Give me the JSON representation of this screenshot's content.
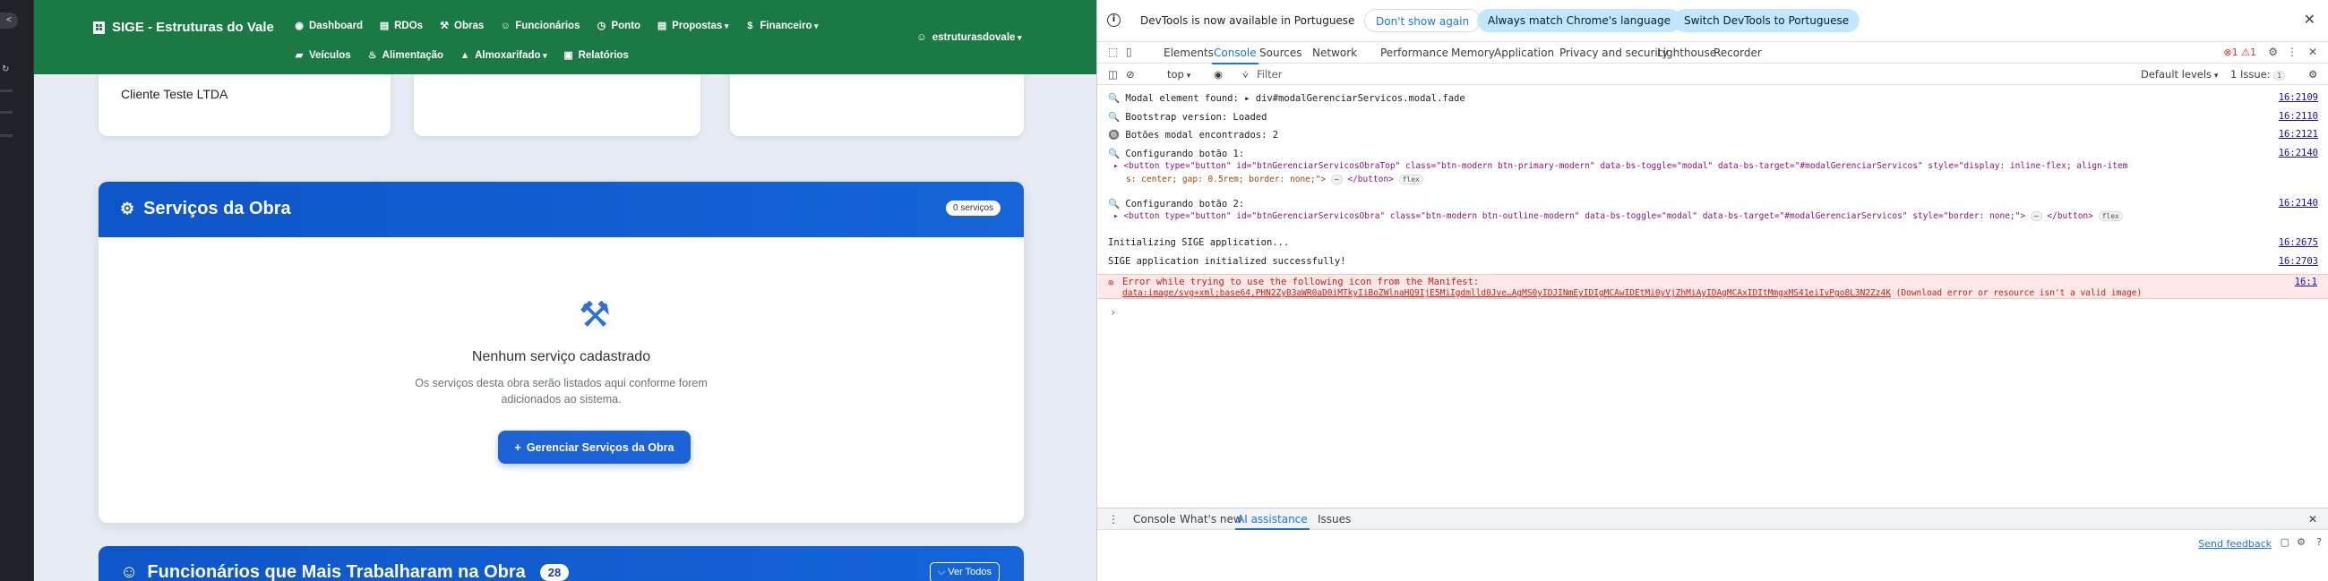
{
  "app": {
    "brand": "SIGE - Estruturas do Vale",
    "nav_row1": [
      {
        "label": "Dashboard",
        "icon": "dashboard-icon",
        "glyph": "◉",
        "caret": false
      },
      {
        "label": "RDOs",
        "icon": "file-icon",
        "glyph": "▤",
        "caret": false
      },
      {
        "label": "Obras",
        "icon": "hammer-icon",
        "glyph": "⚒",
        "caret": false
      },
      {
        "label": "Funcionários",
        "icon": "users-icon",
        "glyph": "☺",
        "caret": false
      },
      {
        "label": "Ponto",
        "icon": "clock-icon",
        "glyph": "◷",
        "caret": false
      },
      {
        "label": "Propostas",
        "icon": "document-icon",
        "glyph": "▤",
        "caret": true
      },
      {
        "label": "Financeiro",
        "icon": "dollar-icon",
        "glyph": "$",
        "caret": true
      }
    ],
    "nav_row2": [
      {
        "label": "Veículos",
        "icon": "car-icon",
        "glyph": "▰",
        "caret": false
      },
      {
        "label": "Alimentação",
        "icon": "utensils-icon",
        "glyph": "♨",
        "caret": false
      },
      {
        "label": "Almoxarifado",
        "icon": "warehouse-icon",
        "glyph": "▲",
        "caret": true
      },
      {
        "label": "Relatórios",
        "icon": "report-icon",
        "glyph": "▣",
        "caret": false
      }
    ],
    "user": "estruturasdovale",
    "client_text": "Cliente Teste LTDA",
    "services": {
      "title": "Serviços da Obra",
      "badge": "0 serviços",
      "empty_title": "Nenhum serviço cadastrado",
      "empty_desc": "Os serviços desta obra serão listados aqui conforme forem adicionados ao sistema.",
      "button": "Gerenciar Serviços da Obra"
    },
    "workers": {
      "title": "Funcionários que Mais Trabalharam na Obra",
      "count": "28",
      "button": "Ver Todos"
    }
  },
  "devtools": {
    "infobar": {
      "message": "DevTools is now available in Portuguese",
      "btn_dont_show": "Don't show again",
      "btn_match": "Always match Chrome's language",
      "btn_switch": "Switch DevTools to Portuguese"
    },
    "tabs": [
      "Elements",
      "Console",
      "Sources",
      "Network",
      "Performance",
      "Memory",
      "Application",
      "Privacy and security",
      "Lighthouse",
      "Recorder"
    ],
    "active_tab": "Console",
    "error_count": "1",
    "warning_count": "1",
    "filter": {
      "context": "top",
      "placeholder": "Filter",
      "levels": "Default levels",
      "issues": "1 Issue:",
      "issues_count": "1"
    },
    "console_lines": [
      {
        "text": "🔍 Modal element found:  ▸ div#modalGerenciarServicos.modal.fade",
        "link": "16:2109"
      },
      {
        "text": "🔍 Bootstrap version: Loaded",
        "link": "16:2110"
      },
      {
        "text": "🔘 Botões modal encontrados: 2",
        "link": "16:2121"
      },
      {
        "text": "🔍 Configurando botão 1:",
        "link": "16:2140"
      },
      {
        "text": "🔍 Configurando botão 2:",
        "link": "16:2140"
      },
      {
        "text": "Initializing SIGE application...",
        "link": "16:2675"
      },
      {
        "text": "SIGE application initialized successfully!",
        "link": "16:2703"
      }
    ],
    "button1_html": "▸ <button type=\"button\" id=\"btnGerenciarServicosObraTop\" class=\"btn-modern btn-primary-modern\" data-bs-toggle=\"modal\" data-bs-target=\"#modalGerenciarServicos\" style=\"display: inline-flex; align-item",
    "button1_html_cont": "s: center; gap: 0.5rem; border: none;\">",
    "button2_html": "▸ <button type=\"button\" id=\"btnGerenciarServicosObra\" class=\"btn-modern btn-outline-modern\" data-bs-toggle=\"modal\" data-bs-target=\"#modalGerenciarServicos\" style=\"border: none;\">",
    "flex_pill": "flex",
    "ellipsis_pill": "⋯",
    "close_button": "</button>",
    "error": {
      "line1": "Error while trying to use the following icon from the Manifest:",
      "line2_link": "data:image/svg+xml;base64,PHN2ZyB3aWR0aD0iMTkyIiBoZWlnaHQ9IjE5MiIgdmlld0Jve…AgMS0yIDJINmEyIDIgMCAwIDEtMi0yVjZhMiAyIDAgMCAxIDItMmgxMS41eiIvPgo8L3N2Zz4K",
      "line2_suffix": " (Download error or resource isn't a valid image)",
      "link": "16:1"
    },
    "drawer_tabs": [
      "Console",
      "What's new",
      "AI assistance",
      "Issues"
    ],
    "drawer_active": "AI assistance",
    "feedback": "Send feedback"
  }
}
